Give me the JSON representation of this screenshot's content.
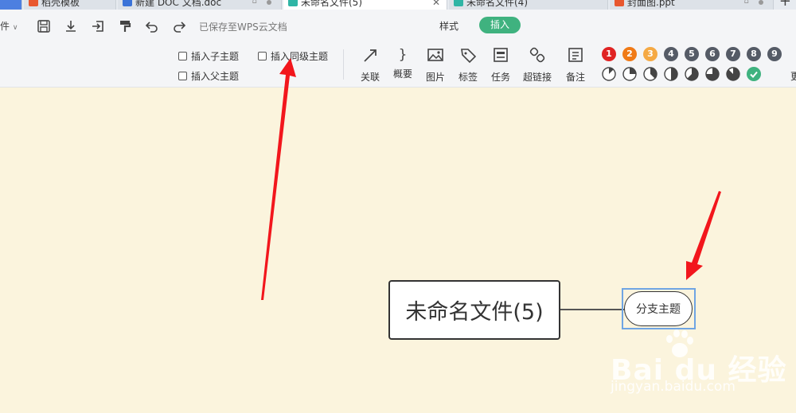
{
  "tabs": [
    {
      "label": "稻壳模板",
      "icon_color": "#e8572e"
    },
    {
      "label": "新建 DOC 文档.doc",
      "icon_color": "#3b73d8"
    },
    {
      "label": "未命名文件(5)",
      "icon_color": "#2fb5a5",
      "active": true
    },
    {
      "label": "未命名文件(4)",
      "icon_color": "#2fb5a5"
    },
    {
      "label": "封面图.ppt",
      "icon_color": "#e8572e"
    }
  ],
  "toolbar": {
    "file_menu": "件",
    "saved_status": "已保存至WPS云文档",
    "style_tab": "样式",
    "insert_tab": "插入"
  },
  "ribbon": {
    "insert_child": "插入子主题",
    "insert_sibling": "插入同级主题",
    "insert_parent": "插入父主题",
    "buttons": [
      {
        "label": "关联",
        "icon": "arrow-link-icon"
      },
      {
        "label": "概要",
        "icon": "summary-brace-icon"
      },
      {
        "label": "图片",
        "icon": "image-icon"
      },
      {
        "label": "标签",
        "icon": "tag-icon"
      },
      {
        "label": "任务",
        "icon": "task-icon"
      },
      {
        "label": "超链接",
        "icon": "hyperlink-icon"
      },
      {
        "label": "备注",
        "icon": "note-icon"
      }
    ],
    "priorities": [
      {
        "label": "1",
        "color": "#e02323"
      },
      {
        "label": "2",
        "color": "#f07a16"
      },
      {
        "label": "3",
        "color": "#f5a944"
      },
      {
        "label": "4",
        "color": "#555b66"
      },
      {
        "label": "5",
        "color": "#555b66"
      },
      {
        "label": "6",
        "color": "#555b66"
      },
      {
        "label": "7",
        "color": "#555b66"
      },
      {
        "label": "8",
        "color": "#555b66"
      },
      {
        "label": "9",
        "color": "#555b66"
      }
    ],
    "progress": [
      0.125,
      0.25,
      0.375,
      0.5,
      0.625,
      0.75,
      0.875
    ],
    "cut_label": "更"
  },
  "canvas": {
    "central_topic": "未命名文件(5)",
    "branch_topic": "分支主题"
  },
  "watermark": {
    "brand": "Bai du 经验",
    "url": "jingyan.baidu.com"
  }
}
